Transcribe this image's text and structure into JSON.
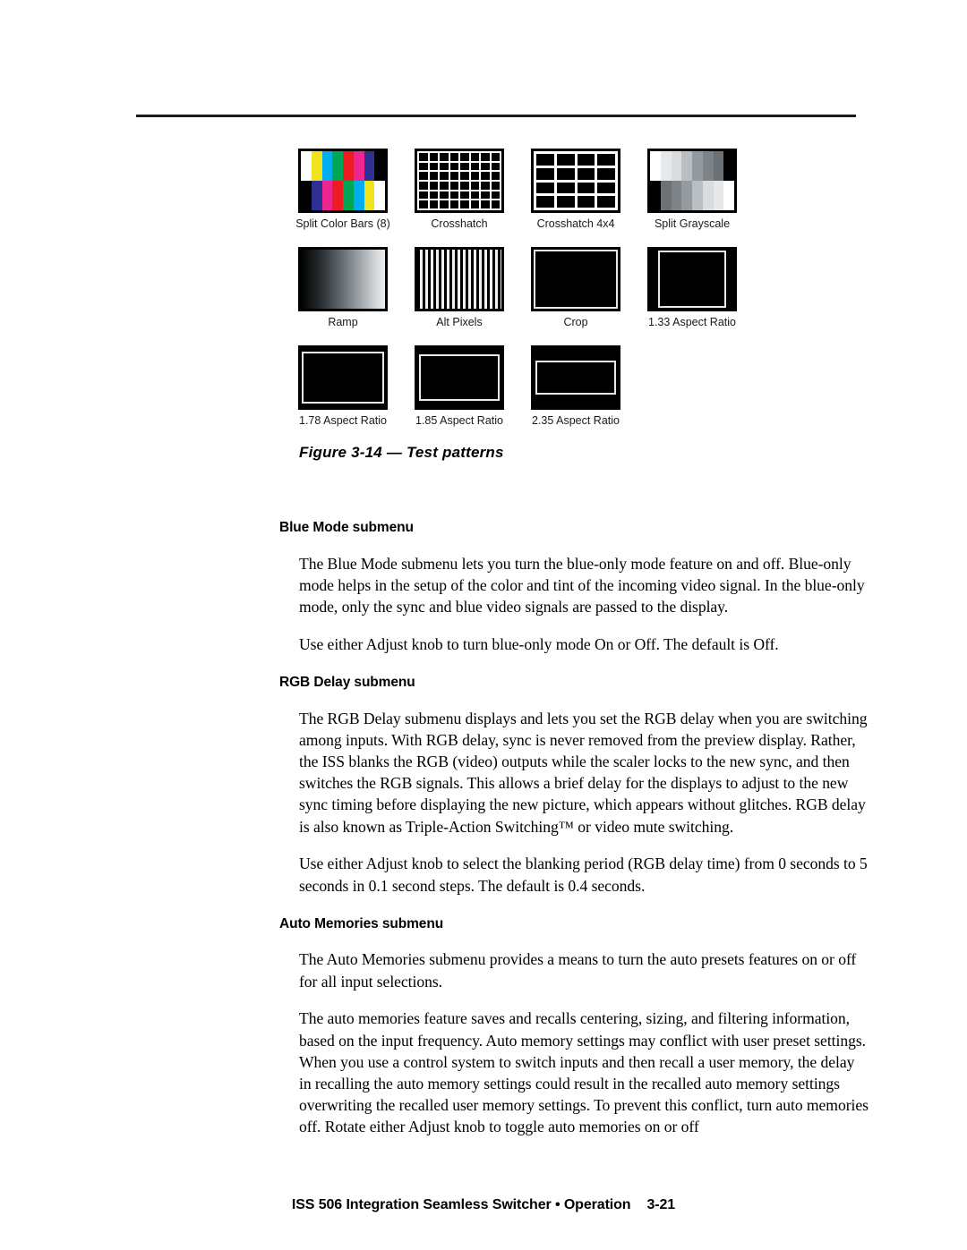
{
  "document": {
    "figure": {
      "caption": "Figure 3-14 — Test patterns",
      "rows": [
        [
          {
            "label": "Split Color Bars (8)",
            "pattern": "split-color-bars"
          },
          {
            "label": "Crosshatch",
            "pattern": "crosshatch-8x6"
          },
          {
            "label": "Crosshatch 4x4",
            "pattern": "crosshatch-4x4"
          },
          {
            "label": "Split Grayscale",
            "pattern": "split-grayscale"
          }
        ],
        [
          {
            "label": "Ramp",
            "pattern": "ramp"
          },
          {
            "label": "Alt Pixels",
            "pattern": "alt-pixels"
          },
          {
            "label": "Crop",
            "pattern": "crop-frame"
          },
          {
            "label": "1.33 Aspect Ratio",
            "pattern": "aspect-frame-1.33"
          }
        ],
        [
          {
            "label": "1.78 Aspect Ratio",
            "pattern": "aspect-frame-1.78"
          },
          {
            "label": "1.85 Aspect Ratio",
            "pattern": "aspect-frame-1.85"
          },
          {
            "label": "2.35 Aspect Ratio",
            "pattern": "aspect-frame-2.35"
          }
        ]
      ],
      "colors": {
        "bar_top": [
          "#ffffff",
          "#f2e320",
          "#00aeef",
          "#00a651",
          "#ed1c24",
          "#ec2590",
          "#2e3192",
          "#000000"
        ],
        "bar_bottom": [
          "#000000",
          "#2e3192",
          "#ec2590",
          "#ed1c24",
          "#00a651",
          "#00aeef",
          "#f2e320",
          "#ffffff"
        ],
        "grayscale_top": [
          "#ffffff",
          "#e6e8ea",
          "#dadde0",
          "#b9bec2",
          "#959a9e",
          "#7d8387",
          "#6b7175",
          "#000000"
        ],
        "grayscale_bottom": [
          "#000000",
          "#6b7175",
          "#7d8387",
          "#959a9e",
          "#b9bec2",
          "#dadde0",
          "#e6e8ea",
          "#ffffff"
        ]
      }
    },
    "sections": [
      {
        "heading": "Blue Mode submenu",
        "paragraphs": [
          "The Blue Mode submenu lets you turn the blue-only mode feature on and off.  Blue-only mode helps in the setup of the color and tint of the incoming video signal.  In the blue-only mode, only the sync and blue video signals are passed to the display.",
          "Use either Adjust knob to turn blue-only mode On or Off.  The default is Off."
        ]
      },
      {
        "heading": "RGB Delay submenu",
        "paragraphs": [
          "The RGB Delay submenu displays and lets you set the RGB delay when you are switching among inputs.  With RGB delay, sync is never removed from the preview display.  Rather, the ISS blanks the RGB (video) outputs while the scaler locks to the new sync, and then switches the RGB signals.  This allows a brief delay for the displays to adjust to the new sync timing before displaying the new picture, which appears without glitches.  RGB delay is also known as Triple-Action Switching™ or video mute switching.",
          "Use either Adjust knob to select the blanking period (RGB delay time) from 0 seconds to 5 seconds in 0.1 second steps.  The default is 0.4 seconds."
        ]
      },
      {
        "heading": "Auto Memories submenu",
        "paragraphs": [
          "The Auto Memories submenu provides a means to turn the auto presets features on or off for all input selections.",
          "The auto memories feature saves and recalls centering, sizing, and filtering information, based on the input frequency.  Auto memory settings may conflict with user preset settings.  When you use a control system to switch inputs and then recall a user memory, the delay in recalling the auto memory settings could result in the recalled auto memory settings overwriting the recalled user memory settings.  To prevent this conflict, turn auto memories off.  Rotate either Adjust knob to toggle auto memories on or off"
        ]
      }
    ],
    "footer": {
      "title": "ISS 506 Integration Seamless Switcher • Operation",
      "page_number": "3-21"
    }
  }
}
